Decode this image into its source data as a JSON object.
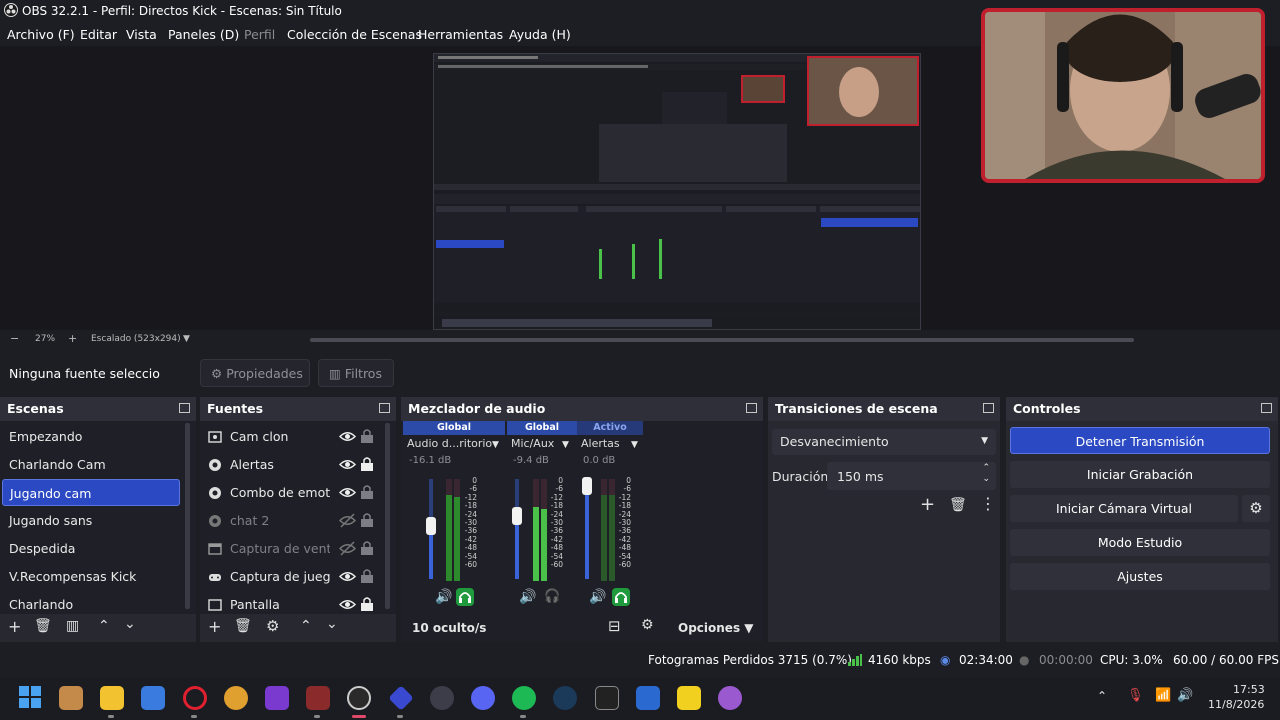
{
  "window": {
    "title": "OBS 32.2.1 - Perfil: Directos Kick - Escenas: Sin Título"
  },
  "menu": [
    "Archivo (F)",
    "Editar",
    "Vista",
    "Paneles (D)",
    "Perfil",
    "Colección de Escenas",
    "Herramientas",
    "Ayuda (H)"
  ],
  "preview": {
    "zoom": "27%",
    "scale": "Escalado (523x294)"
  },
  "props_bar": {
    "no_source": "Ninguna fuente seleccionada",
    "properties": "Propiedades",
    "filters": "Filtros"
  },
  "scenes": {
    "title": "Escenas",
    "items": [
      "Empezando",
      "Charlando Cam",
      "Jugando cam",
      "Jugando sans",
      "Despedida",
      "V.Recompensas Kick",
      "Charlando"
    ],
    "selected": "Jugando cam"
  },
  "sources": {
    "title": "Fuentes",
    "items": [
      {
        "label": "Cam clon",
        "icon": "camera-icon",
        "visible": true,
        "locked": false
      },
      {
        "label": "Alertas",
        "icon": "browser-icon",
        "visible": true,
        "locked": true
      },
      {
        "label": "Combo de emotes",
        "icon": "browser-icon",
        "visible": true,
        "locked": false
      },
      {
        "label": "chat 2",
        "icon": "browser-icon",
        "visible": false,
        "locked": false
      },
      {
        "label": "Captura de ventana",
        "icon": "window-icon",
        "visible": false,
        "locked": false
      },
      {
        "label": "Captura de juego",
        "icon": "gamepad-icon",
        "visible": true,
        "locked": false
      },
      {
        "label": "Pantalla",
        "icon": "monitor-icon",
        "visible": true,
        "locked": true
      }
    ]
  },
  "mixer": {
    "title": "Mezclador de audio",
    "channels": [
      {
        "tag": "Global",
        "name": "Audio d...ritorio",
        "db": "-16.1 dB",
        "monitor": true
      },
      {
        "tag": "Global",
        "name": "Mic/Aux",
        "db": "-9.4 dB",
        "monitor": false
      },
      {
        "tag": "Activo",
        "name": "Alertas",
        "db": "0.0 dB",
        "monitor": true
      }
    ],
    "scale": [
      "0",
      "-6",
      "-12",
      "-18",
      "-24",
      "-30",
      "-36",
      "-42",
      "-48",
      "-54",
      "-60"
    ],
    "hidden": "10 oculto/s",
    "options": "Opciones"
  },
  "transitions": {
    "title": "Transiciones de escena",
    "selected": "Desvanecimiento",
    "duration_label": "Duración",
    "duration": "150 ms"
  },
  "controls": {
    "title": "Controles",
    "stop_stream": "Detener Transmisión",
    "start_record": "Iniciar Grabación",
    "virtual_cam": "Iniciar Cámara Virtual",
    "studio": "Modo Estudio",
    "settings": "Ajustes"
  },
  "status": {
    "dropped": "Fotogramas Perdidos 3715 (0.7%)",
    "bitrate": "4160 kbps",
    "stream_time": "02:34:00",
    "rec_time": "00:00:00",
    "cpu": "CPU: 3.0%",
    "fps": "60.00 / 60.00 FPS"
  },
  "taskbar": {
    "time": "17:53",
    "date": "11/8/2026"
  },
  "colors": {
    "accent": "#2a49c2",
    "bg": "#1d1e24",
    "dock": "#272830",
    "meter_green": "#4ac24a",
    "cam_border": "#c0202e"
  }
}
